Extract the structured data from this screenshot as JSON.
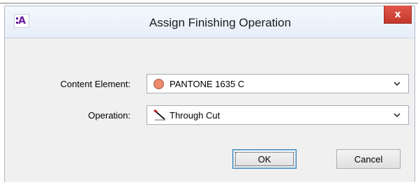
{
  "dialog": {
    "title": "Assign Finishing Operation",
    "app_icon": "A",
    "close_glyph": "x"
  },
  "fields": {
    "content_element": {
      "label": "Content Element:",
      "value": "PANTONE 1635 C",
      "swatch_color": "#ee8a6a",
      "icon": "color-circle-icon"
    },
    "operation": {
      "label": "Operation:",
      "value": "Through Cut",
      "icon": "knife-icon"
    }
  },
  "buttons": {
    "ok_label": "OK",
    "cancel_label": "Cancel"
  }
}
